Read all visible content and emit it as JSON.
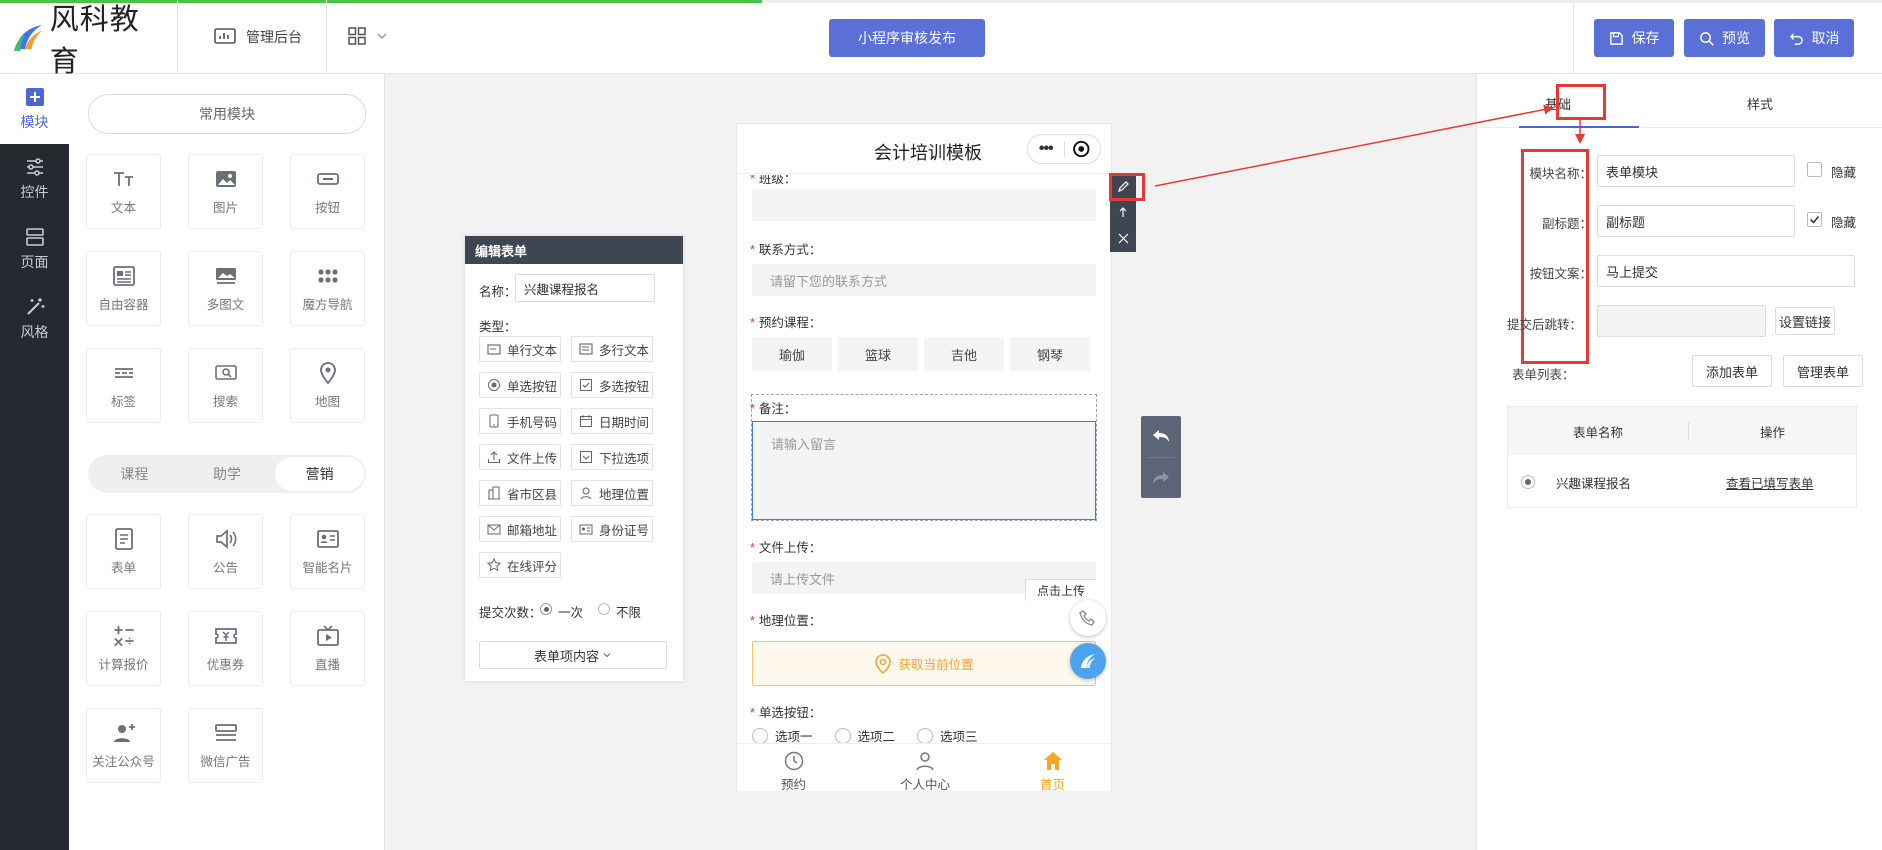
{
  "topbar": {
    "brand": "风科教育",
    "admin_label": "管理后台",
    "publish_label": "小程序审核发布",
    "save_label": "保存",
    "preview_label": "预览",
    "cancel_label": "取消",
    "progress": 0.405
  },
  "rail": [
    {
      "label": "模块",
      "icon": "plus-square-icon",
      "active": true
    },
    {
      "label": "控件",
      "icon": "sliders-icon"
    },
    {
      "label": "页面",
      "icon": "page-layout-icon"
    },
    {
      "label": "风格",
      "icon": "magic-wand-icon"
    }
  ],
  "modules": {
    "common_title": "常用模块",
    "common": [
      "文本",
      "图片",
      "按钮",
      "自由容器",
      "多图文",
      "魔方导航",
      "标签",
      "搜索",
      "地图"
    ],
    "segments": [
      "课程",
      "助学",
      "营销"
    ],
    "active_segment": "营销",
    "marketing": [
      "表单",
      "公告",
      "智能名片",
      "计算报价",
      "优惠券",
      "直播",
      "关注公众号",
      "微信广告"
    ]
  },
  "editor": {
    "title": "编辑表单",
    "name_label": "名称：",
    "name_value": "兴趣课程报名",
    "type_label": "类型：",
    "types": [
      "单行文本",
      "多行文本",
      "单选按钮",
      "多选按钮",
      "手机号码",
      "日期时间",
      "文件上传",
      "下拉选项",
      "省市区县",
      "地理位置",
      "邮箱地址",
      "身份证号",
      "在线评分"
    ],
    "submit_count_label": "提交次数：",
    "submit_options": [
      "一次",
      "不限"
    ],
    "items_button": "表单项内容"
  },
  "phone": {
    "title": "会计培训模板",
    "class_label": "班级：",
    "contact_label": "联系方式：",
    "contact_placeholder": "请留下您的联系方式",
    "course_label": "预约课程：",
    "courses": [
      "瑜伽",
      "篮球",
      "吉他",
      "钢琴"
    ],
    "note_label": "备注：",
    "note_placeholder": "请输入留言",
    "upload_label": "文件上传：",
    "upload_placeholder": "请上传文件",
    "upload_button": "点击上传",
    "location_label": "地理位置：",
    "location_button": "获取当前位置",
    "radio_label": "单选按钮：",
    "radio_options": [
      "选项一",
      "选项二",
      "选项三"
    ],
    "tabs": [
      {
        "label": "预约",
        "icon": "clock-icon"
      },
      {
        "label": "个人中心",
        "icon": "user-icon"
      },
      {
        "label": "首页",
        "icon": "home-icon"
      }
    ],
    "active_tab": "首页"
  },
  "right": {
    "tabs": [
      "基础",
      "样式"
    ],
    "active_tab": "基础",
    "module_name_label": "模块名称：",
    "module_name_value": "表单模块",
    "subtitle_label": "副标题：",
    "subtitle_value": "副标题",
    "button_text_label": "按钮文案：",
    "button_text_value": "马上提交",
    "hide_label": "隐藏",
    "redirect_label": "提交后跳转：",
    "set_link_button": "设置链接",
    "form_list_label": "表单列表：",
    "add_form_button": "添加表单",
    "manage_form_button": "管理表单",
    "table_headers": [
      "表单名称",
      "操作"
    ],
    "table_rows": [
      {
        "name": "兴趣课程报名",
        "action": "查看已填写表单"
      }
    ]
  },
  "colors": {
    "accent": "#5a6fd8",
    "annotation": "#e53935",
    "home_tab": "#f5a623",
    "location": "#f3a532"
  }
}
